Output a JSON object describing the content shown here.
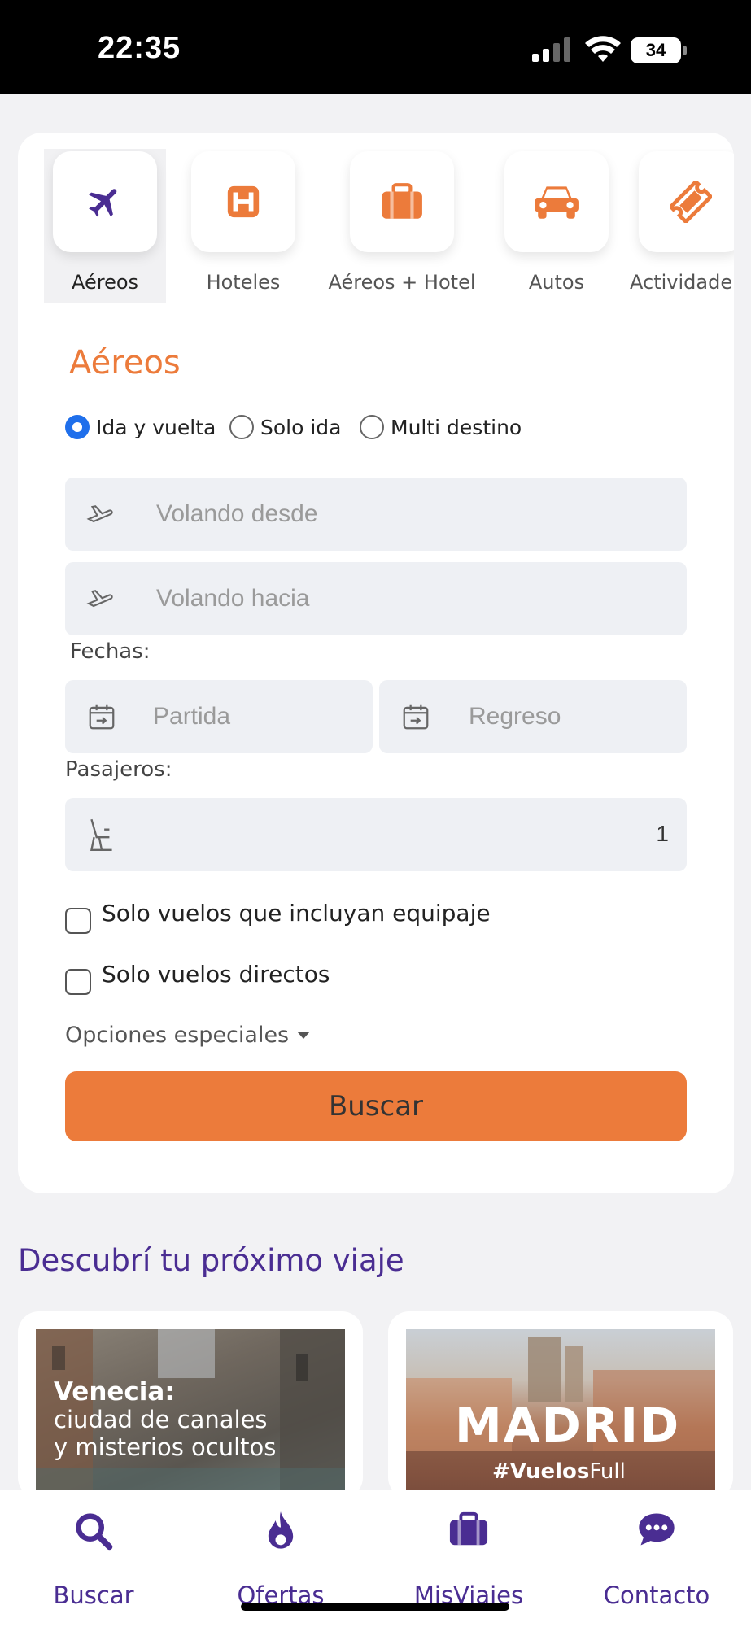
{
  "status_bar": {
    "time": "22:35",
    "battery": "34"
  },
  "tabs": [
    {
      "label": "Aéreos",
      "icon": "plane-icon",
      "active": true
    },
    {
      "label": "Hoteles",
      "icon": "hotel-icon",
      "active": false
    },
    {
      "label": "Aéreos + Hotel",
      "icon": "suitcase-icon",
      "active": false
    },
    {
      "label": "Autos",
      "icon": "car-icon",
      "active": false
    },
    {
      "label": "Actividade",
      "icon": "ticket-icon",
      "active": false
    }
  ],
  "form": {
    "title": "Aéreos",
    "trip_types": [
      {
        "label": "Ida y vuelta",
        "checked": true
      },
      {
        "label": "Solo ida",
        "checked": false
      },
      {
        "label": "Multi destino",
        "checked": false
      }
    ],
    "from_placeholder": "Volando desde",
    "to_placeholder": "Volando hacia",
    "dates_label": "Fechas:",
    "departure_placeholder": "Partida",
    "return_placeholder": "Regreso",
    "passengers_label": "Pasajeros:",
    "passengers_value": "1",
    "baggage_label": "Solo vuelos que incluyan equipaje",
    "direct_label": "Solo vuelos directos",
    "special_options_label": "Opciones especiales",
    "search_label": "Buscar"
  },
  "discover": {
    "title": "Descubrí tu próximo viaje",
    "cards": [
      {
        "title": "Venecia:",
        "subtitle_line1": "ciudad de canales",
        "subtitle_line2": "y misterios ocultos"
      },
      {
        "title": "MADRID",
        "tag_bold": "#Vuelos",
        "tag_light": "Full"
      }
    ]
  },
  "nav": [
    {
      "label": "Buscar",
      "icon": "search-icon"
    },
    {
      "label": "Ofertas",
      "icon": "flame-icon"
    },
    {
      "label": "MisViajes",
      "icon": "suitcase-icon"
    },
    {
      "label": "Contacto",
      "icon": "chat-icon"
    }
  ],
  "colors": {
    "accent": "#ec7b3b",
    "brand": "#4a2d92",
    "radio": "#1f6feb"
  }
}
